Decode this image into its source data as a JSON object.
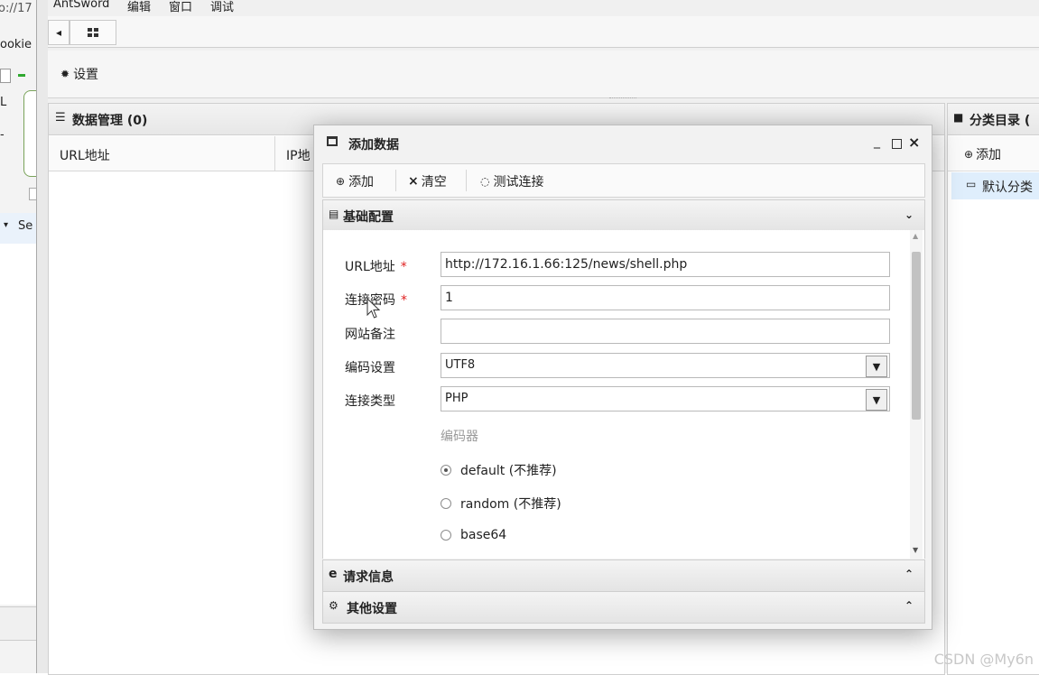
{
  "left_browser": {
    "url_fragment": "o://17",
    "cookie_fragment": "ookie",
    "l_fragment": "L",
    "dash": "-",
    "se_fragment": "Se"
  },
  "menubar": {
    "items": [
      "AntSword",
      "编辑",
      "窗口",
      "调试"
    ]
  },
  "toolbar": {
    "settings_label": "设置"
  },
  "data_panel": {
    "title": "数据管理 (0)",
    "columns": [
      "URL地址",
      "IP地"
    ]
  },
  "category_panel": {
    "title": "分类目录 (",
    "add_label": "添加",
    "default_item": "默认分类"
  },
  "dialog": {
    "title": "添加数据",
    "toolbar": {
      "add_label": "添加",
      "clear_label": "清空",
      "test_label": "测试连接"
    },
    "basic_section": "基础配置",
    "request_section": "请求信息",
    "other_section": "其他设置",
    "form": {
      "url_label": "URL地址",
      "url_value": "http://172.16.1.66:125/news/shell.php",
      "password_label": "连接密码",
      "password_value": "1",
      "note_label": "网站备注",
      "note_value": "",
      "encoding_label": "编码设置",
      "encoding_value": "UTF8",
      "type_label": "连接类型",
      "type_value": "PHP",
      "encoder_label": "编码器",
      "encoders": [
        "default (不推荐)",
        "random (不推荐)",
        "base64"
      ],
      "selected_encoder": "default (不推荐)"
    }
  },
  "watermark": "CSDN @My6n"
}
